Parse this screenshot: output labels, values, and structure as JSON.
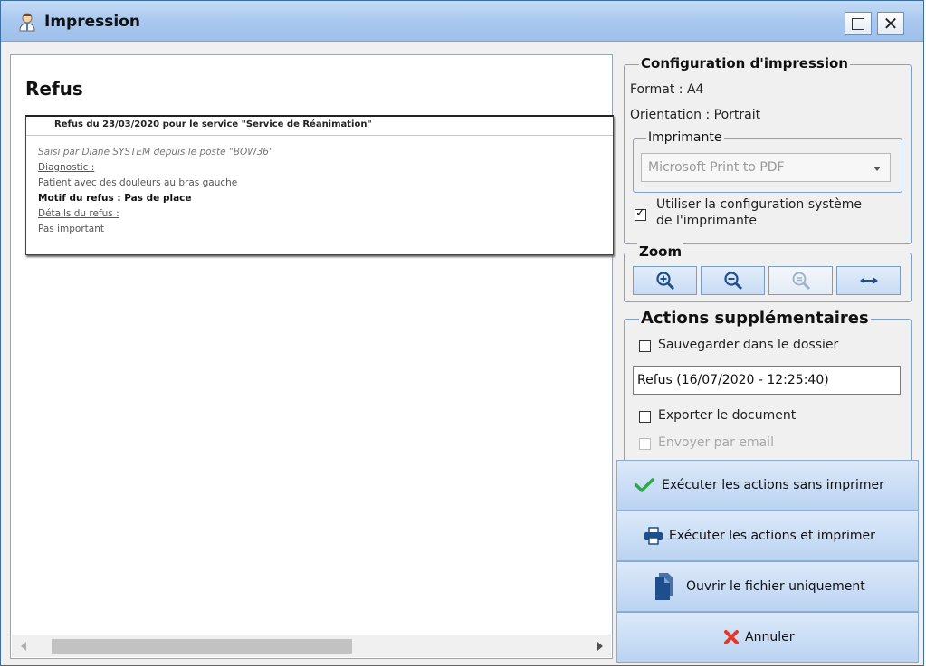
{
  "window": {
    "title": "Impression"
  },
  "preview": {
    "title": "Refus",
    "doc_header": "Refus du 23/03/2020 pour le service \"Service de Réanimation\"",
    "lines": [
      "Saisi par Diane SYSTEM depuis le poste \"BOW36\"",
      "Diagnostic :",
      "Patient avec des douleurs au bras gauche",
      "Motif du refus : Pas de place",
      "Détails du refus :",
      "Pas important"
    ]
  },
  "config": {
    "title": "Configuration d'impression",
    "format": "Format : A4",
    "orientation": "Orientation : Portrait",
    "printer_group": "Imprimante",
    "printer_value": "Microsoft Print to PDF",
    "use_system_line1": "Utiliser la configuration système",
    "use_system_line2": "de l'imprimante",
    "use_system_checked": true
  },
  "zoom": {
    "title": "Zoom",
    "buttons": [
      "zoom-in-icon",
      "zoom-out-icon",
      "zoom-reset-icon",
      "fit-width-icon"
    ]
  },
  "actions": {
    "title": "Actions supplémentaires",
    "save_label": "Sauvegarder dans le dossier",
    "save_checked": false,
    "filename_value": "Refus (16/07/2020 - 12:25:40)",
    "export_label": "Exporter le document",
    "export_checked": false,
    "email_label": "Envoyer par email",
    "email_enabled": false
  },
  "buttons": {
    "run_no_print": "Exécuter les actions sans imprimer",
    "run_and_print": "Exécuter les actions et imprimer",
    "open_file": "Ouvrir le fichier uniquement",
    "cancel": "Annuler"
  },
  "colors": {
    "check_green": "#2ea84a",
    "cancel_red": "#e03a2c",
    "icon_blue": "#1f4e8c"
  }
}
